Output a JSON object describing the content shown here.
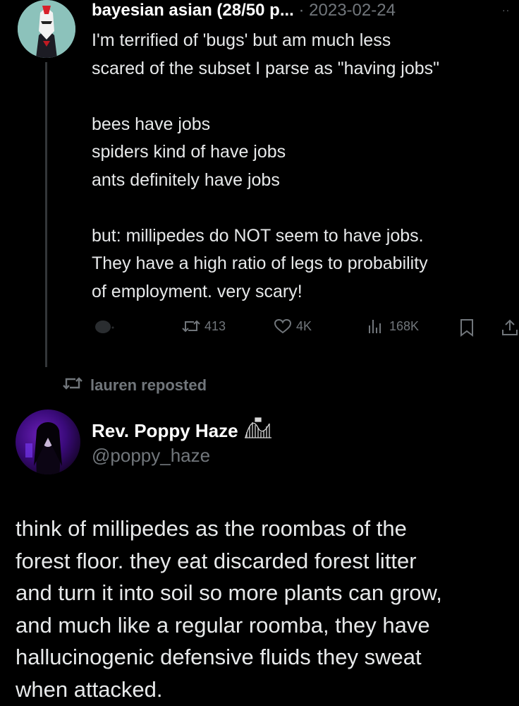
{
  "post1": {
    "display_name": "bayesian asian (28/50 p...",
    "separator": " · ",
    "date": "2023-02-24",
    "more": "··",
    "text": "I'm terrified of 'bugs' but am much less\nscared of the subset I parse as \"having jobs\"\n\nbees have jobs\nspiders kind of have jobs\nants definitely have jobs\n\nbut: millipedes do NOT seem to have jobs.\nThey have a high ratio of legs to probability\nof employment. very scary!",
    "actions": {
      "reply_icon": "reply-icon",
      "repost_icon": "repost-icon",
      "reposts": "413",
      "like_icon": "heart-icon",
      "likes": "4K",
      "views_icon": "views-icon",
      "views": "168K",
      "bookmark_icon": "bookmark-icon",
      "share_icon": "share-icon"
    }
  },
  "repost_banner": {
    "icon": "repost-icon",
    "text": "lauren reposted"
  },
  "post2": {
    "display_name": "Rev. Poppy Haze",
    "badge_icon": "rollercoaster-emoji-icon",
    "handle": "@poppy_haze",
    "text": "think of millipedes as the roombas of the\nforest floor. they eat discarded forest litter\nand turn it into soil so more plants can grow,\nand much like a regular roomba, they have\nhallucinogenic defensive fluids they sweat\nwhen attacked."
  },
  "colors": {
    "background": "#000000",
    "text": "#e7e9ea",
    "secondary": "#71767b",
    "thread_line": "#333639"
  }
}
